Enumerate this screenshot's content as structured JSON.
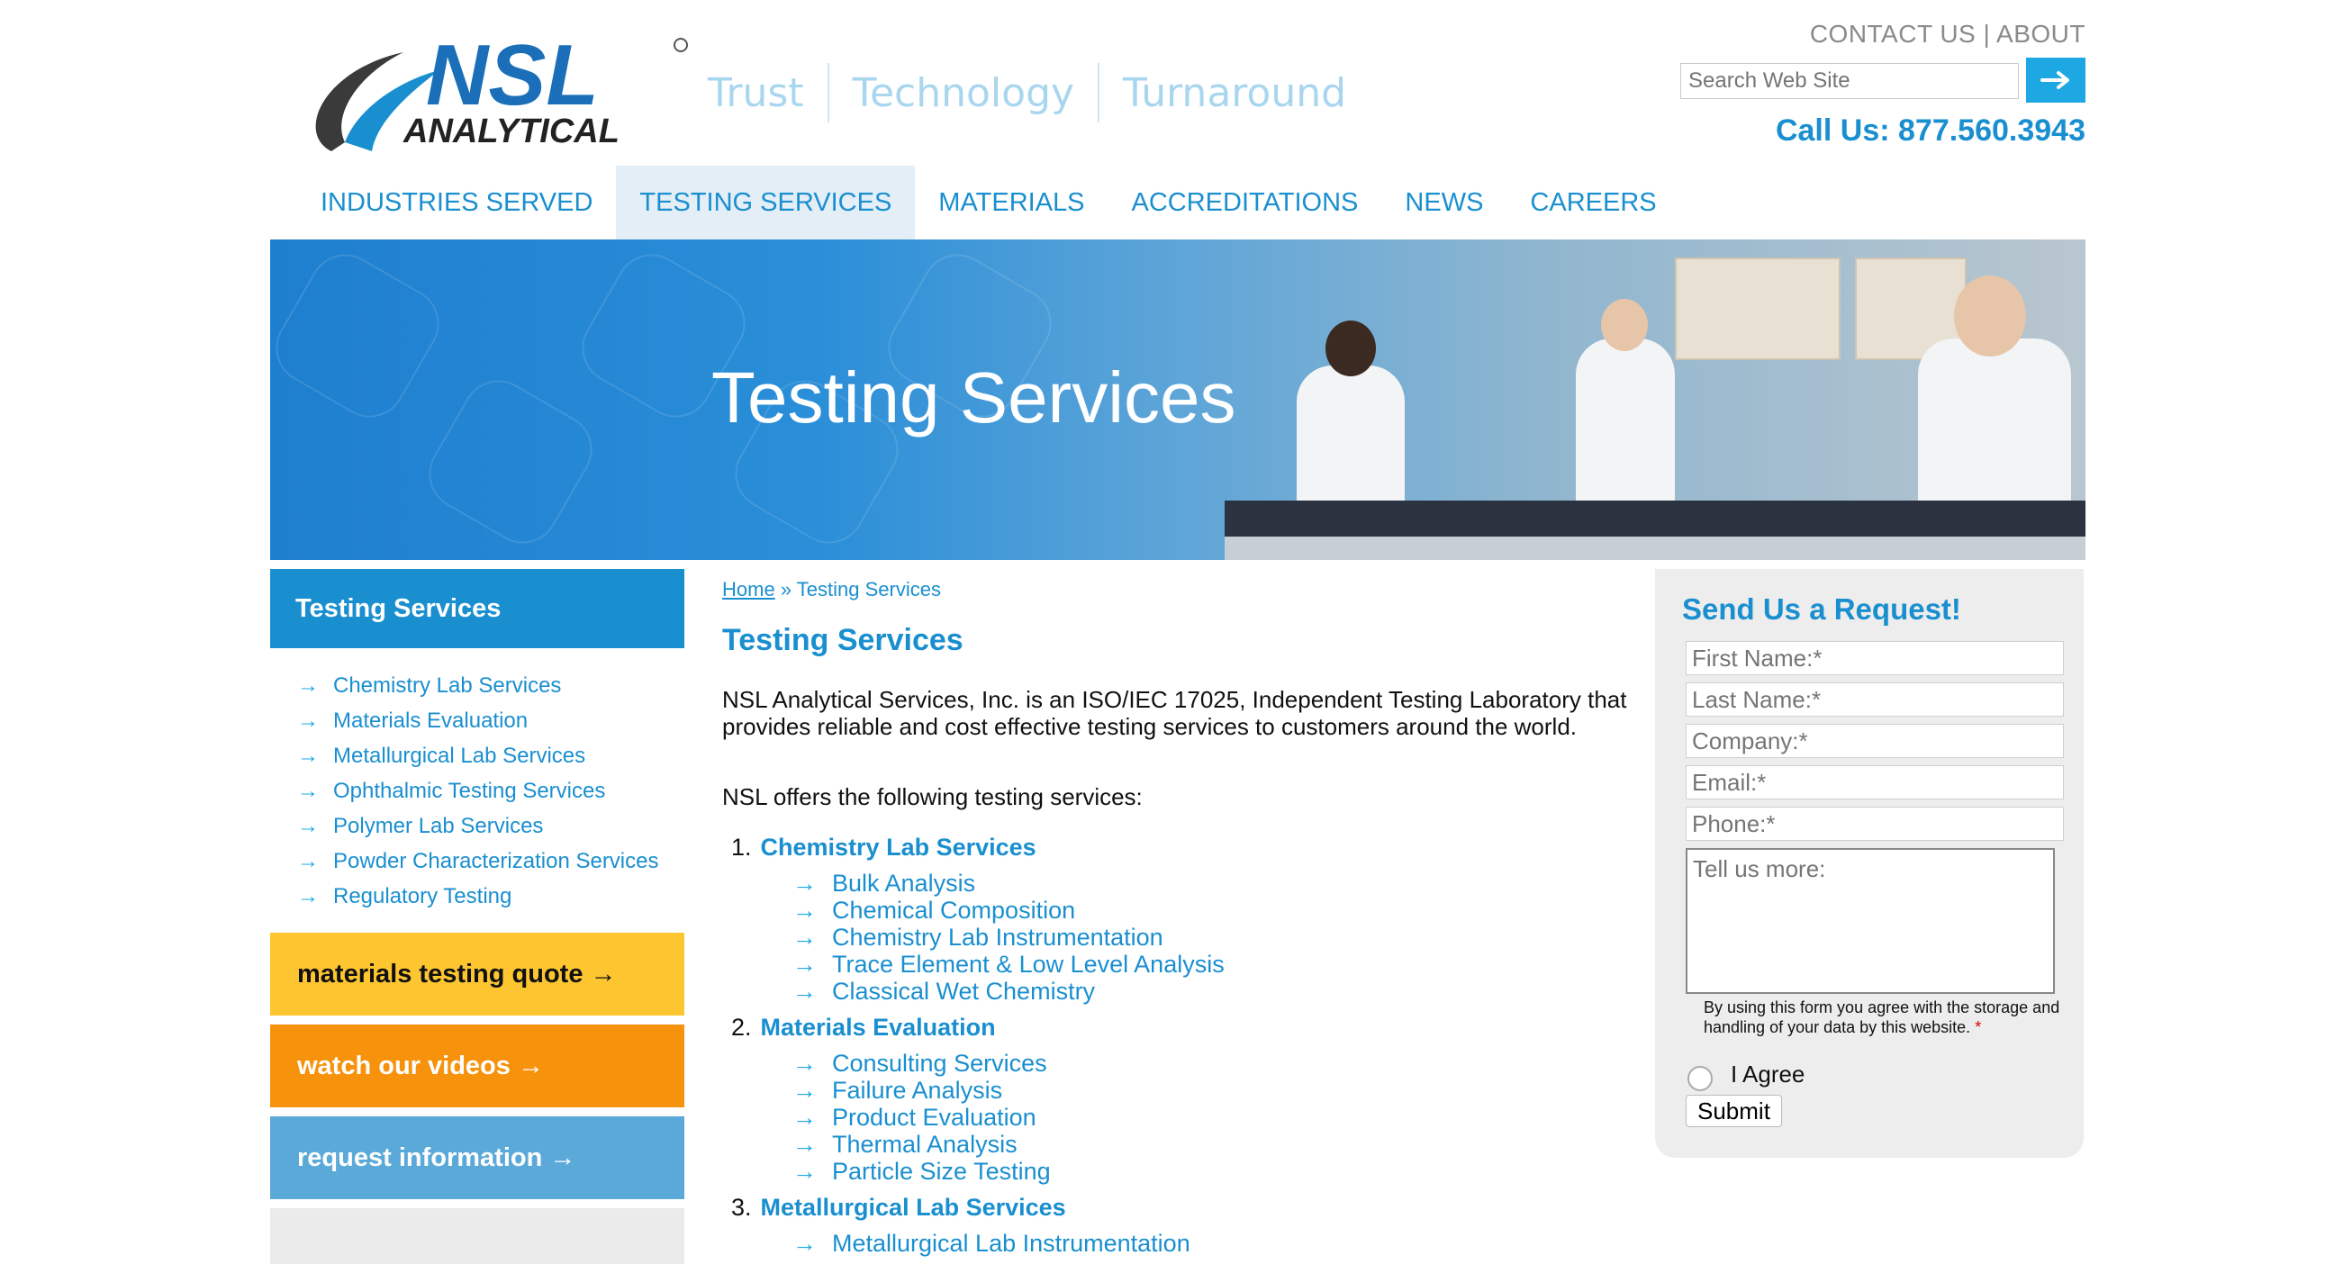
{
  "header": {
    "logo_text_top": "NSL",
    "logo_text_bottom": "ANALYTICAL",
    "tagline": [
      "Trust",
      "Technology",
      "Turnaround"
    ],
    "contact_label": "CONTACT US",
    "about_label": "ABOUT",
    "separator": "|",
    "search_placeholder": "Search Web Site",
    "call_us": "Call Us: 877.560.3943"
  },
  "nav": {
    "items": [
      "INDUSTRIES SERVED",
      "TESTING SERVICES",
      "MATERIALS",
      "ACCREDITATIONS",
      "NEWS",
      "CAREERS"
    ],
    "active": "TESTING SERVICES"
  },
  "hero": {
    "title": "Testing Services"
  },
  "sidebar": {
    "heading": "Testing Services",
    "items": [
      "Chemistry Lab Services",
      "Materials Evaluation",
      "Metallurgical Lab Services",
      "Ophthalmic Testing Services",
      "Polymer Lab Services",
      "Powder Characterization Services",
      "Regulatory Testing"
    ],
    "cta": [
      "materials testing quote →",
      "watch our videos →",
      "request information →"
    ]
  },
  "main": {
    "breadcrumb_home": "Home",
    "breadcrumb_sep": "»",
    "breadcrumb_current": "Testing Services",
    "title": "Testing Services",
    "intro": "NSL Analytical Services, Inc. is an ISO/IEC 17025, Independent Testing Laboratory that provides reliable and cost effective testing services to customers around the world.",
    "offers": "NSL offers the following testing services:",
    "services": [
      {
        "num": "1.",
        "name": "Chemistry Lab Services",
        "subs": [
          "Bulk Analysis",
          "Chemical Composition",
          "Chemistry Lab Instrumentation",
          "Trace Element & Low Level Analysis",
          "Classical Wet Chemistry"
        ]
      },
      {
        "num": "2.",
        "name": "Materials Evaluation",
        "subs": [
          "Consulting Services",
          "Failure Analysis",
          "Product Evaluation",
          "Thermal Analysis",
          "Particle Size Testing"
        ]
      },
      {
        "num": "3.",
        "name": "Metallurgical Lab Services",
        "subs": [
          "Metallurgical Lab Instrumentation"
        ]
      }
    ]
  },
  "form": {
    "title": "Send Us a Request!",
    "fields": [
      "First Name:*",
      "Last Name:*",
      "Company:*",
      "Email:*",
      "Phone:*"
    ],
    "message_placeholder": "Tell us more:",
    "consent": "By using this form you agree with the storage and handling of your data by this website.",
    "required_mark": "*",
    "agree_label": "I Agree",
    "submit_label": "Submit"
  },
  "colors": {
    "brand_blue": "#1a8fd0",
    "quote_yellow": "#fdc530",
    "videos_orange": "#f7920d",
    "request_blue": "#5aa9d9"
  }
}
